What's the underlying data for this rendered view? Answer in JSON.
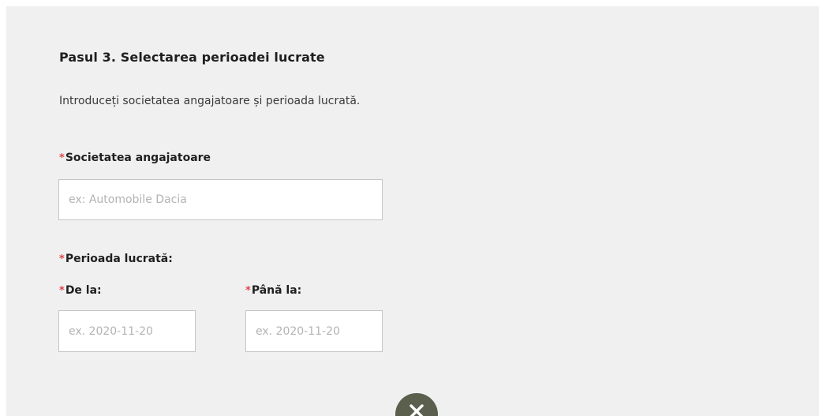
{
  "form": {
    "step_title": "Pasul 3. Selectarea perioadei lucrate",
    "intro": "Introduceți societatea angajatoare și perioada lucrată.",
    "required_marker": "*",
    "company": {
      "label": "Societatea angajatoare",
      "placeholder": "ex: Automobile Dacia",
      "value": ""
    },
    "period": {
      "label": "Perioada lucrată:"
    },
    "from": {
      "label": "De la:",
      "placeholder": "ex. 2020-11-20",
      "value": ""
    },
    "to": {
      "label": "Până la:",
      "placeholder": "ex. 2020-11-20",
      "value": ""
    }
  },
  "controls": {
    "close_icon": "close-icon",
    "close_color": "#5b5f4e"
  },
  "colors": {
    "panel_background": "#f0f0f0",
    "required_marker": "#e0434b",
    "input_border": "#c4c6c2"
  }
}
